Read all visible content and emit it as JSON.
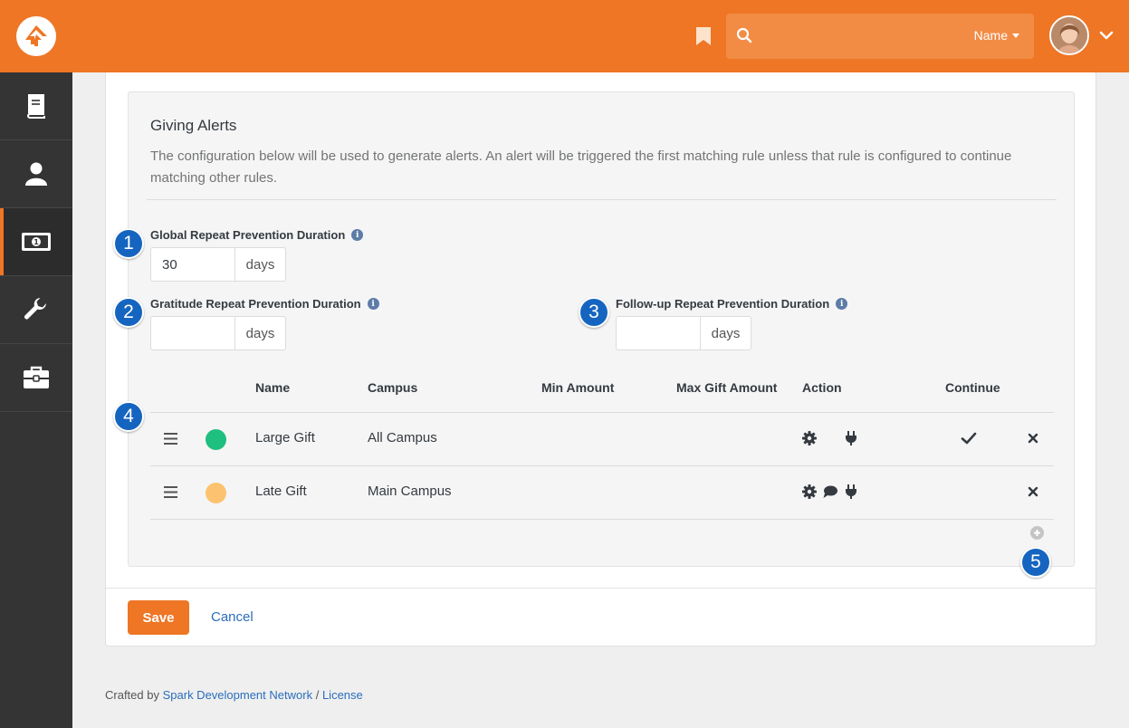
{
  "header": {
    "search_filter": "Name",
    "search_placeholder": ""
  },
  "colors": {
    "brand": "#ee7625",
    "sidebar": "#343434",
    "badge": "#1565c0",
    "large_gift_dot": "#1fbf7f",
    "late_gift_dot": "#fcc270"
  },
  "sidebar": {
    "items": [
      {
        "icon": "book-icon"
      },
      {
        "icon": "person-icon"
      },
      {
        "icon": "money-icon",
        "active": true
      },
      {
        "icon": "wrench-icon"
      },
      {
        "icon": "briefcase-icon"
      }
    ]
  },
  "giving_alerts": {
    "title": "Giving Alerts",
    "description": "The configuration below will be used to generate alerts. An alert will be triggered the first matching rule unless that rule is configured to continue matching other rules.",
    "global_label": "Global Repeat Prevention Duration",
    "global_value": "30",
    "gratitude_label": "Gratitude Repeat Prevention Duration",
    "gratitude_value": "",
    "followup_label": "Follow-up Repeat Prevention Duration",
    "followup_value": "",
    "unit": "days"
  },
  "table": {
    "headers": {
      "name": "Name",
      "campus": "Campus",
      "min_amount": "Min Amount",
      "max_amount": "Max Gift Amount",
      "action": "Action",
      "continue": "Continue"
    },
    "rows": [
      {
        "name": "Large Gift",
        "campus": "All Campus",
        "continue": true
      },
      {
        "name": "Late Gift",
        "campus": "Main Campus",
        "continue": false
      }
    ]
  },
  "badges": [
    "1",
    "2",
    "3",
    "4",
    "5"
  ],
  "actions": {
    "save": "Save",
    "cancel": "Cancel"
  },
  "footer": {
    "crafted_by": "Crafted by",
    "org": "Spark Development Network",
    "separator": "/",
    "license": "License"
  }
}
